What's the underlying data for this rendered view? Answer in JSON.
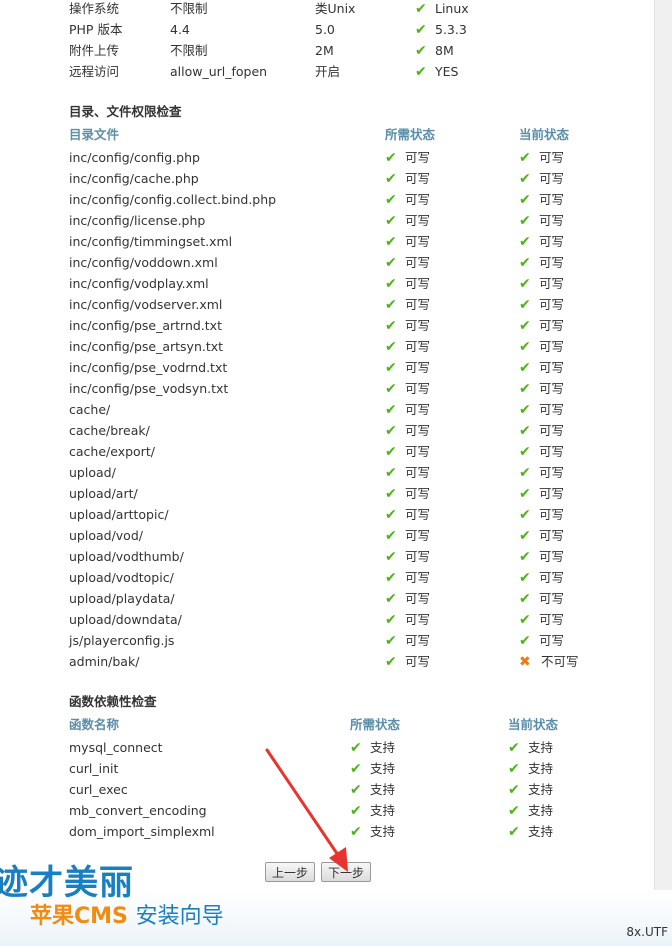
{
  "env": {
    "rows": [
      {
        "name": "操作系统",
        "required": "不限制",
        "recommended": "类Unix",
        "current": "Linux"
      },
      {
        "name": "PHP 版本",
        "required": "4.4",
        "recommended": "5.0",
        "current": "5.3.3"
      },
      {
        "name": "附件上传",
        "required": "不限制",
        "recommended": "2M",
        "current": "8M"
      },
      {
        "name": "远程访问",
        "required": "allow_url_fopen",
        "recommended": "开启",
        "current": "YES"
      }
    ]
  },
  "dirs": {
    "title": "目录、文件权限检查",
    "headers": {
      "file": "目录文件",
      "required": "所需状态",
      "current": "当前状态"
    },
    "rows": [
      {
        "path": "inc/config/config.php",
        "required": "可写",
        "current": "可写",
        "ok": true
      },
      {
        "path": "inc/config/cache.php",
        "required": "可写",
        "current": "可写",
        "ok": true
      },
      {
        "path": "inc/config/config.collect.bind.php",
        "required": "可写",
        "current": "可写",
        "ok": true
      },
      {
        "path": "inc/config/license.php",
        "required": "可写",
        "current": "可写",
        "ok": true
      },
      {
        "path": "inc/config/timmingset.xml",
        "required": "可写",
        "current": "可写",
        "ok": true
      },
      {
        "path": "inc/config/voddown.xml",
        "required": "可写",
        "current": "可写",
        "ok": true
      },
      {
        "path": "inc/config/vodplay.xml",
        "required": "可写",
        "current": "可写",
        "ok": true
      },
      {
        "path": "inc/config/vodserver.xml",
        "required": "可写",
        "current": "可写",
        "ok": true
      },
      {
        "path": "inc/config/pse_artrnd.txt",
        "required": "可写",
        "current": "可写",
        "ok": true
      },
      {
        "path": "inc/config/pse_artsyn.txt",
        "required": "可写",
        "current": "可写",
        "ok": true
      },
      {
        "path": "inc/config/pse_vodrnd.txt",
        "required": "可写",
        "current": "可写",
        "ok": true
      },
      {
        "path": "inc/config/pse_vodsyn.txt",
        "required": "可写",
        "current": "可写",
        "ok": true
      },
      {
        "path": "cache/",
        "required": "可写",
        "current": "可写",
        "ok": true
      },
      {
        "path": "cache/break/",
        "required": "可写",
        "current": "可写",
        "ok": true
      },
      {
        "path": "cache/export/",
        "required": "可写",
        "current": "可写",
        "ok": true
      },
      {
        "path": "upload/",
        "required": "可写",
        "current": "可写",
        "ok": true
      },
      {
        "path": "upload/art/",
        "required": "可写",
        "current": "可写",
        "ok": true
      },
      {
        "path": "upload/arttopic/",
        "required": "可写",
        "current": "可写",
        "ok": true
      },
      {
        "path": "upload/vod/",
        "required": "可写",
        "current": "可写",
        "ok": true
      },
      {
        "path": "upload/vodthumb/",
        "required": "可写",
        "current": "可写",
        "ok": true
      },
      {
        "path": "upload/vodtopic/",
        "required": "可写",
        "current": "可写",
        "ok": true
      },
      {
        "path": "upload/playdata/",
        "required": "可写",
        "current": "可写",
        "ok": true
      },
      {
        "path": "upload/downdata/",
        "required": "可写",
        "current": "可写",
        "ok": true
      },
      {
        "path": "js/playerconfig.js",
        "required": "可写",
        "current": "可写",
        "ok": true
      },
      {
        "path": "admin/bak/",
        "required": "可写",
        "current": "不可写",
        "ok": false
      }
    ]
  },
  "funcs": {
    "title": "函数依赖性检查",
    "headers": {
      "name": "函数名称",
      "required": "所需状态",
      "current": "当前状态"
    },
    "rows": [
      {
        "name": "mysql_connect",
        "required": "支持",
        "current": "支持"
      },
      {
        "name": "curl_init",
        "required": "支持",
        "current": "支持"
      },
      {
        "name": "curl_exec",
        "required": "支持",
        "current": "支持"
      },
      {
        "name": "mb_convert_encoding",
        "required": "支持",
        "current": "支持"
      },
      {
        "name": "dom_import_simplexml",
        "required": "支持",
        "current": "支持"
      }
    ]
  },
  "buttons": {
    "prev": "上一步",
    "next": "下一步"
  },
  "footer": {
    "slogan": "迹才美丽",
    "brand": "苹果CMS",
    "wizard": "安装向导",
    "encoding": "8x.UTF"
  },
  "icons": {
    "ok": "check-icon",
    "fail": "cross-icon"
  },
  "colors": {
    "ok": "#4db319",
    "fail": "#f07a14",
    "header": "#5b8ea8",
    "brand_blue": "#1a7fc0",
    "brand_orange": "#f08c12",
    "arrow": "#e8332e"
  }
}
